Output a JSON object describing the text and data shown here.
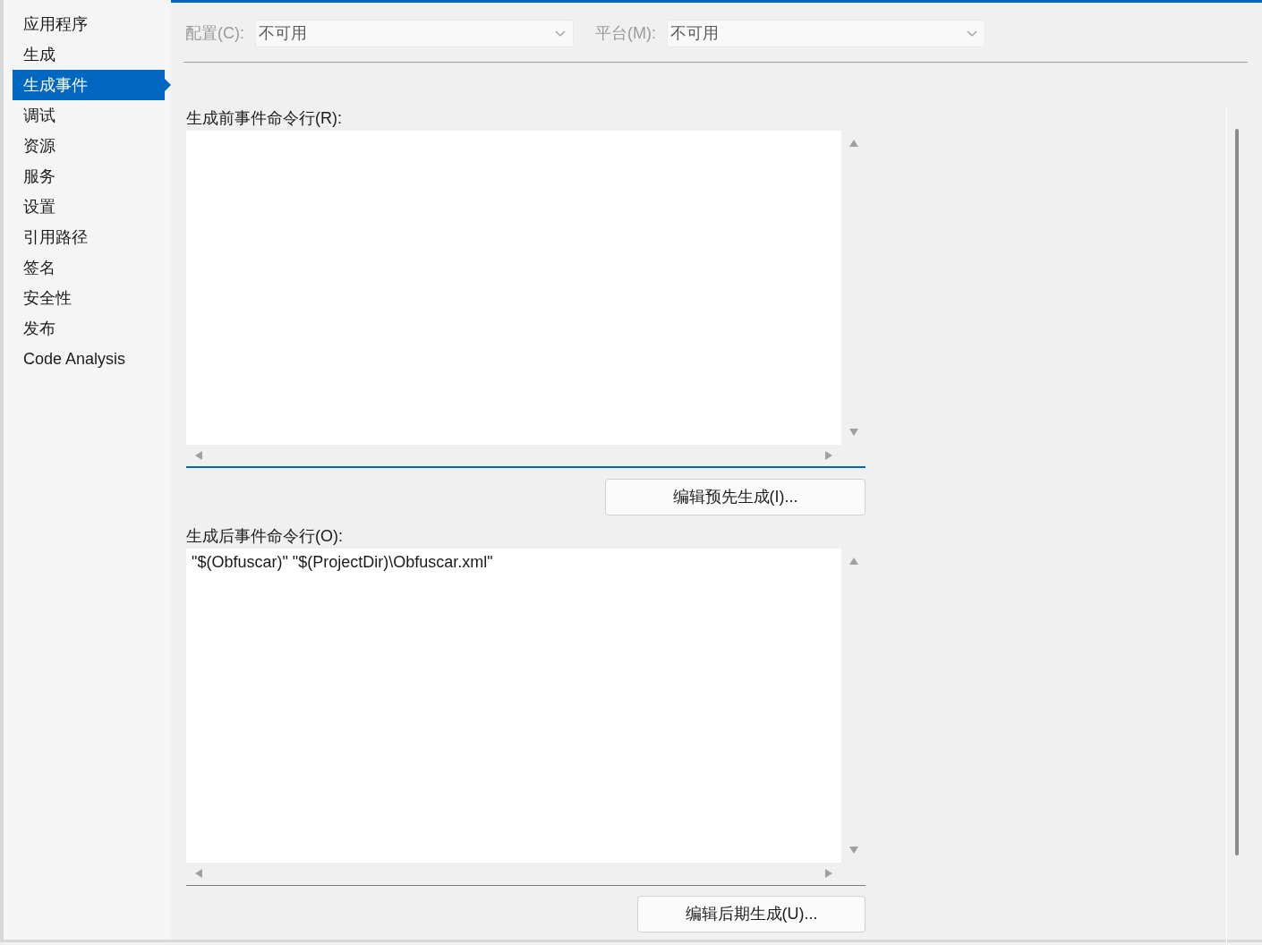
{
  "sidebar": {
    "items": [
      {
        "label": "应用程序",
        "selected": false
      },
      {
        "label": "生成",
        "selected": false
      },
      {
        "label": "生成事件",
        "selected": true
      },
      {
        "label": "调试",
        "selected": false
      },
      {
        "label": "资源",
        "selected": false
      },
      {
        "label": "服务",
        "selected": false
      },
      {
        "label": "设置",
        "selected": false
      },
      {
        "label": "引用路径",
        "selected": false
      },
      {
        "label": "签名",
        "selected": false
      },
      {
        "label": "安全性",
        "selected": false
      },
      {
        "label": "发布",
        "selected": false
      },
      {
        "label": "Code Analysis",
        "selected": false
      }
    ]
  },
  "toolbar": {
    "fields": [
      {
        "label": "配置(C):",
        "value": "不可用",
        "disabled": true
      },
      {
        "label": "平台(M):",
        "value": "不可用",
        "disabled": true
      }
    ]
  },
  "sections": [
    {
      "label": "生成前事件命令行(R):",
      "focused": true,
      "button": "编辑预先生成(I)..."
    },
    {
      "label": "生成后事件命令行(O):",
      "value": "\"$(Obfuscar)\" \"$(ProjectDir)\\Obfuscar.xml\"",
      "focused": false,
      "button": "编辑后期生成(U)..."
    }
  ]
}
